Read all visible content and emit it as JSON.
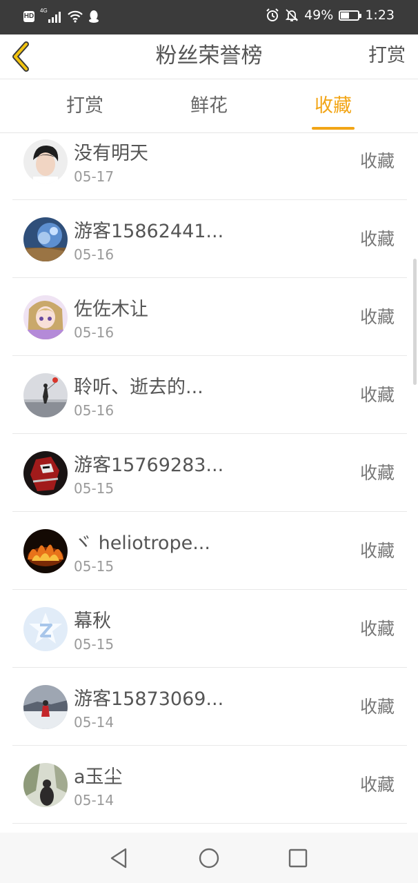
{
  "status_bar": {
    "network_type": "4G",
    "battery_level": "49%",
    "battery_fraction": 0.49,
    "time": "1:23",
    "icons": [
      "hd-icon",
      "signal-icon",
      "wifi-icon",
      "qq-icon",
      "alarm-icon",
      "mute-icon",
      "battery-icon"
    ]
  },
  "header": {
    "title": "粉丝荣誉榜",
    "right_action": "打赏",
    "back_icon": "chevron-left-icon"
  },
  "tabs": [
    {
      "label": "打赏",
      "active": false
    },
    {
      "label": "鲜花",
      "active": false
    },
    {
      "label": "收藏",
      "active": true
    }
  ],
  "accent_color": "#f2a516",
  "list": [
    {
      "name": "没有明天",
      "date": "05-17",
      "action": "收藏"
    },
    {
      "name": "游客15862441...",
      "date": "05-16",
      "action": "收藏"
    },
    {
      "name": "佐佐木让",
      "date": "05-16",
      "action": "收藏"
    },
    {
      "name": "聆听、逝去的...",
      "date": "05-16",
      "action": "收藏"
    },
    {
      "name": "游客15769283...",
      "date": "05-15",
      "action": "收藏"
    },
    {
      "name": "ヾ heliotrope...",
      "date": "05-15",
      "action": "收藏"
    },
    {
      "name": "幕秋",
      "date": "05-15",
      "action": "收藏"
    },
    {
      "name": "游客15873069...",
      "date": "05-14",
      "action": "收藏"
    },
    {
      "name": "a玉尘",
      "date": "05-14",
      "action": "收藏"
    }
  ],
  "system_nav": [
    "back-triangle-icon",
    "home-circle-icon",
    "recents-square-icon"
  ]
}
